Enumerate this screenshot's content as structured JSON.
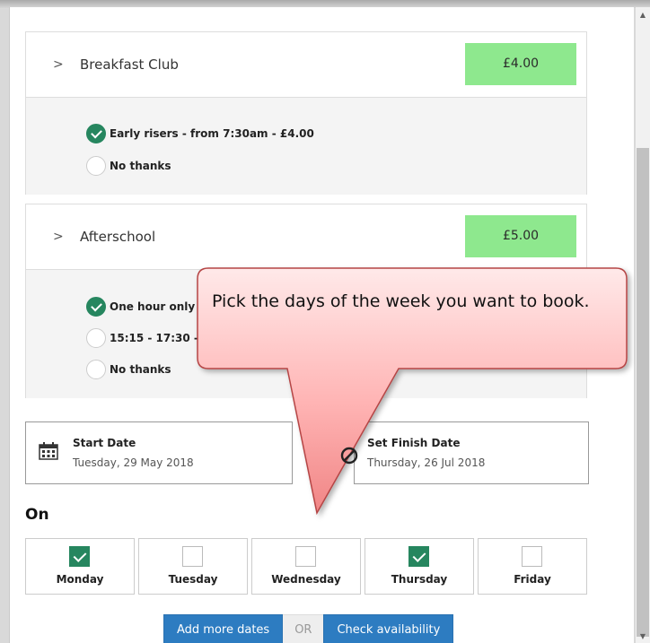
{
  "sections": [
    {
      "title": "Breakfast Club",
      "price": "£4.00",
      "options": [
        {
          "label": "Early risers - from 7:30am - £4.00",
          "selected": true
        },
        {
          "label": "No thanks",
          "selected": false
        }
      ]
    },
    {
      "title": "Afterschool",
      "price": "£5.00",
      "options": [
        {
          "label": "One hour only",
          "selected": true
        },
        {
          "label": "15:15 - 17:30 -",
          "selected": false
        },
        {
          "label": "No thanks",
          "selected": false
        }
      ]
    }
  ],
  "start_date": {
    "label": "Start Date",
    "value": "Tuesday, 29 May 2018",
    "icon": "calendar-icon"
  },
  "finish_date": {
    "label": "Set Finish Date",
    "value": "Thursday, 26 Jul 2018",
    "icon": "no-entry-icon"
  },
  "on_label": "On",
  "days": [
    {
      "label": "Monday",
      "checked": true
    },
    {
      "label": "Tuesday",
      "checked": false
    },
    {
      "label": "Wednesday",
      "checked": false
    },
    {
      "label": "Thursday",
      "checked": true
    },
    {
      "label": "Friday",
      "checked": false
    }
  ],
  "buttons": {
    "add_more": "Add more dates",
    "or": "OR",
    "check": "Check availability"
  },
  "callout": {
    "text": "Pick the days of the week you want to book."
  },
  "colors": {
    "accent_green": "#26865f",
    "price_green": "#8ee88e",
    "button_blue": "#2d7cc1",
    "callout_red": "#f08585"
  }
}
